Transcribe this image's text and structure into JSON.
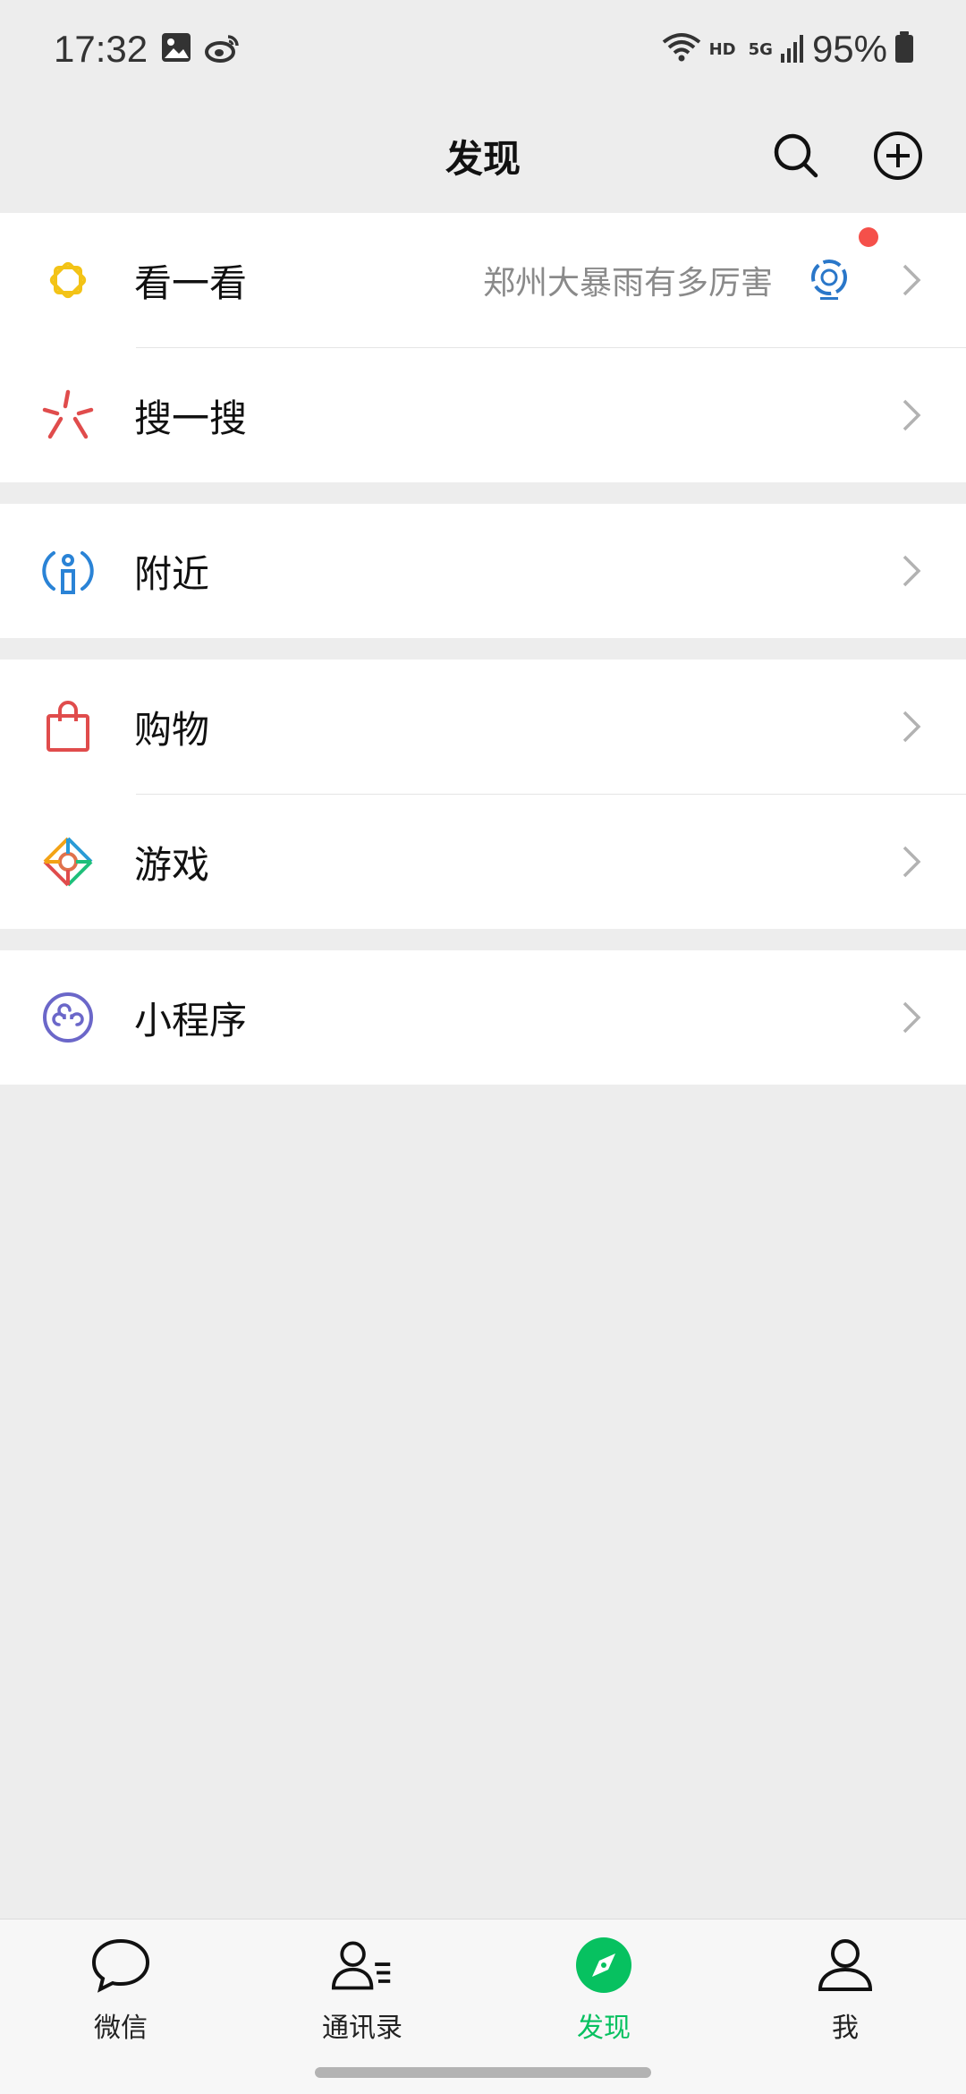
{
  "status_bar": {
    "time": "17:32",
    "network_label": "HD",
    "cell_label": "5G",
    "battery": "95%"
  },
  "header": {
    "title": "发现",
    "icons": [
      "search-icon",
      "add-circle-icon"
    ]
  },
  "groups": [
    {
      "items": [
        {
          "label": "看一看",
          "subtitle": "郑州大暴雨有多厉害",
          "icon": "moments-star-icon",
          "has_badge": true
        },
        {
          "label": "搜一搜",
          "icon": "search-spark-icon"
        }
      ]
    },
    {
      "items": [
        {
          "label": "附近",
          "icon": "nearby-icon"
        }
      ]
    },
    {
      "items": [
        {
          "label": "购物",
          "icon": "shopping-bag-icon"
        },
        {
          "label": "游戏",
          "icon": "game-diamond-icon"
        }
      ]
    },
    {
      "items": [
        {
          "label": "小程序",
          "icon": "mini-program-icon"
        }
      ]
    }
  ],
  "tabbar": {
    "tabs": [
      {
        "label": "微信",
        "icon": "chat-bubble-icon",
        "active": false
      },
      {
        "label": "通讯录",
        "icon": "contacts-icon",
        "active": false
      },
      {
        "label": "发现",
        "icon": "compass-icon",
        "active": true
      },
      {
        "label": "我",
        "icon": "profile-icon",
        "active": false
      }
    ]
  },
  "colors": {
    "background": "#ededed",
    "accent_green": "#07c160",
    "badge_red": "#f5504a"
  }
}
